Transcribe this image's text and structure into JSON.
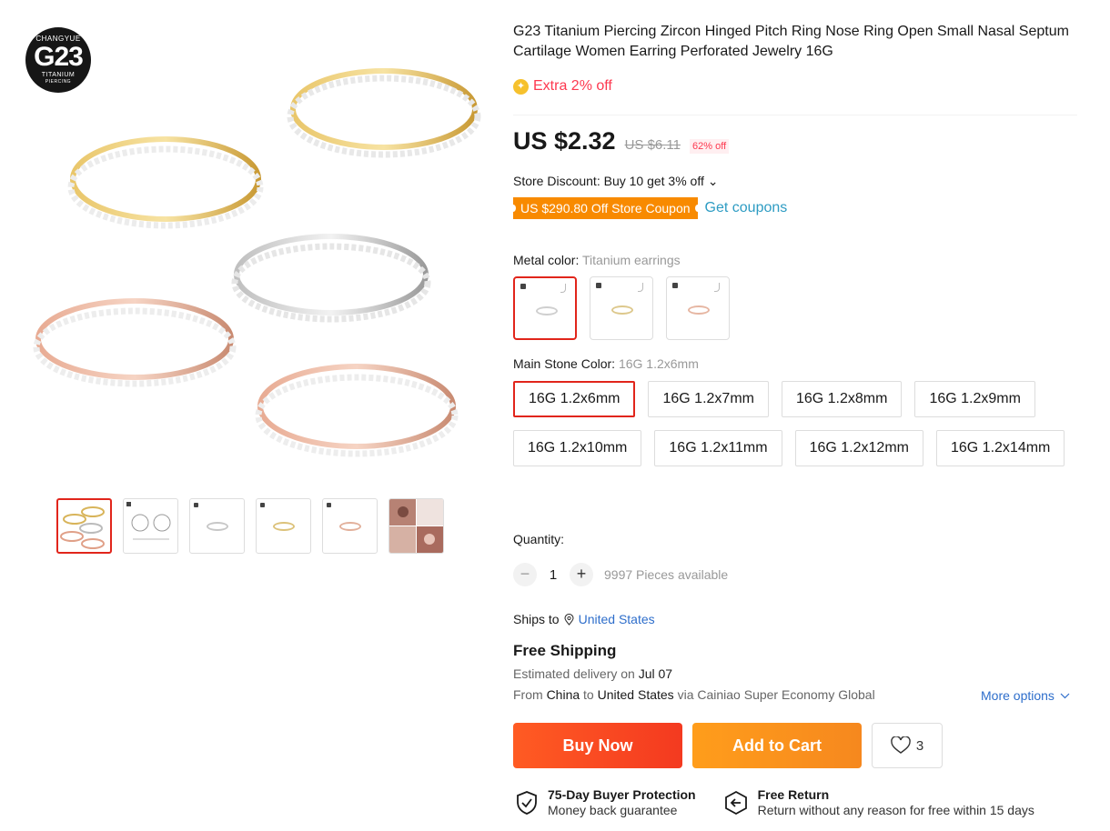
{
  "brand": {
    "top": "CHANGYUE",
    "main": "G23",
    "sub": "TITANIUM",
    "sub2": "PIERCING"
  },
  "product": {
    "title": "G23 Titanium Piercing Zircon Hinged Pitch Ring Nose Ring Open Small Nasal Septum Cartilage Women Earring Perforated Jewelry 16G",
    "extra_offer": "Extra 2% off"
  },
  "price": {
    "current": "US $2.32",
    "original": "US $6.11",
    "discount": "62% off"
  },
  "store_discount": "Store Discount: Buy 10 get 3% off ⌄",
  "coupon": {
    "label": "US $290.80 Off Store Coupon",
    "get": "Get coupons"
  },
  "metal_color": {
    "label": "Metal color:",
    "value": "Titanium earrings",
    "options": [
      "silver",
      "gold",
      "rose"
    ]
  },
  "stone": {
    "label": "Main Stone Color:",
    "value": "16G 1.2x6mm",
    "options": [
      "16G 1.2x6mm",
      "16G 1.2x7mm",
      "16G 1.2x8mm",
      "16G 1.2x9mm",
      "16G 1.2x10mm",
      "16G 1.2x11mm",
      "16G 1.2x12mm",
      "16G 1.2x14mm"
    ]
  },
  "quantity": {
    "label": "Quantity:",
    "minus": "−",
    "value": "1",
    "plus": "+",
    "available": "9997 Pieces available"
  },
  "shipping": {
    "ships_to": "Ships to",
    "country": "United States",
    "free": "Free Shipping",
    "est_prefix": "Estimated delivery on ",
    "est_date": "Jul 07",
    "from_prefix": "From ",
    "from_country": "China",
    "to_word": " to ",
    "to_country": "United States",
    "via": " via Cainiao Super Economy Global",
    "more": "More options"
  },
  "actions": {
    "buy": "Buy Now",
    "cart": "Add to Cart",
    "wish_count": "3"
  },
  "guarantees": {
    "protection_title": "75-Day Buyer Protection",
    "protection_sub": "Money back guarantee",
    "return_title": "Free Return",
    "return_sub": "Return without any reason for free within 15 days"
  },
  "colors": {
    "accent": "#e1251b",
    "buy": "#f43a20",
    "cart": "#f6881e",
    "link": "#2e6ecb",
    "coupon": "#f88a00"
  }
}
